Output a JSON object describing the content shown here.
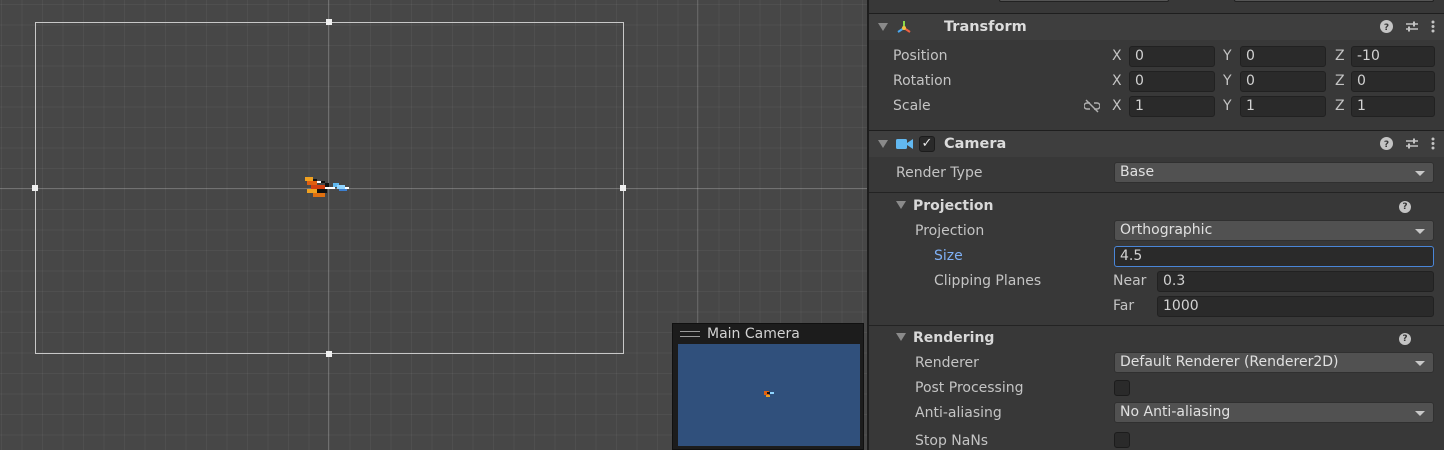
{
  "scene": {
    "camera_preview": {
      "title": "Main Camera"
    }
  },
  "inspector": {
    "transform": {
      "title": "Transform",
      "position": {
        "label": "Position",
        "x": "0",
        "y": "0",
        "z": "-10"
      },
      "rotation": {
        "label": "Rotation",
        "x": "0",
        "y": "0",
        "z": "0"
      },
      "scale": {
        "label": "Scale",
        "x": "1",
        "y": "1",
        "z": "1"
      },
      "axis_labels": {
        "x": "X",
        "y": "Y",
        "z": "Z"
      }
    },
    "camera": {
      "title": "Camera",
      "enabled": true,
      "render_type": {
        "label": "Render Type",
        "value": "Base"
      },
      "projection_section": {
        "title": "Projection",
        "projection": {
          "label": "Projection",
          "value": "Orthographic"
        },
        "size": {
          "label": "Size",
          "value": "4.5"
        },
        "clipping_planes": {
          "label": "Clipping Planes",
          "near_label": "Near",
          "near": "0.3",
          "far_label": "Far",
          "far": "1000"
        }
      },
      "rendering_section": {
        "title": "Rendering",
        "renderer": {
          "label": "Renderer",
          "value": "Default Renderer (Renderer2D)"
        },
        "post_processing": {
          "label": "Post Processing",
          "checked": false
        },
        "anti_aliasing": {
          "label": "Anti-aliasing",
          "value": "No Anti-aliasing"
        },
        "stop_nans": {
          "label": "Stop NaNs",
          "checked": false
        }
      }
    },
    "help_glyph": "?",
    "check_glyph": "✓"
  },
  "colors": {
    "scene_bg": "#474747",
    "inspector_bg": "#383838",
    "focus_blue": "#4a86d8",
    "preview_sky": "#30507c",
    "camera_icon": "#62b8f0"
  }
}
